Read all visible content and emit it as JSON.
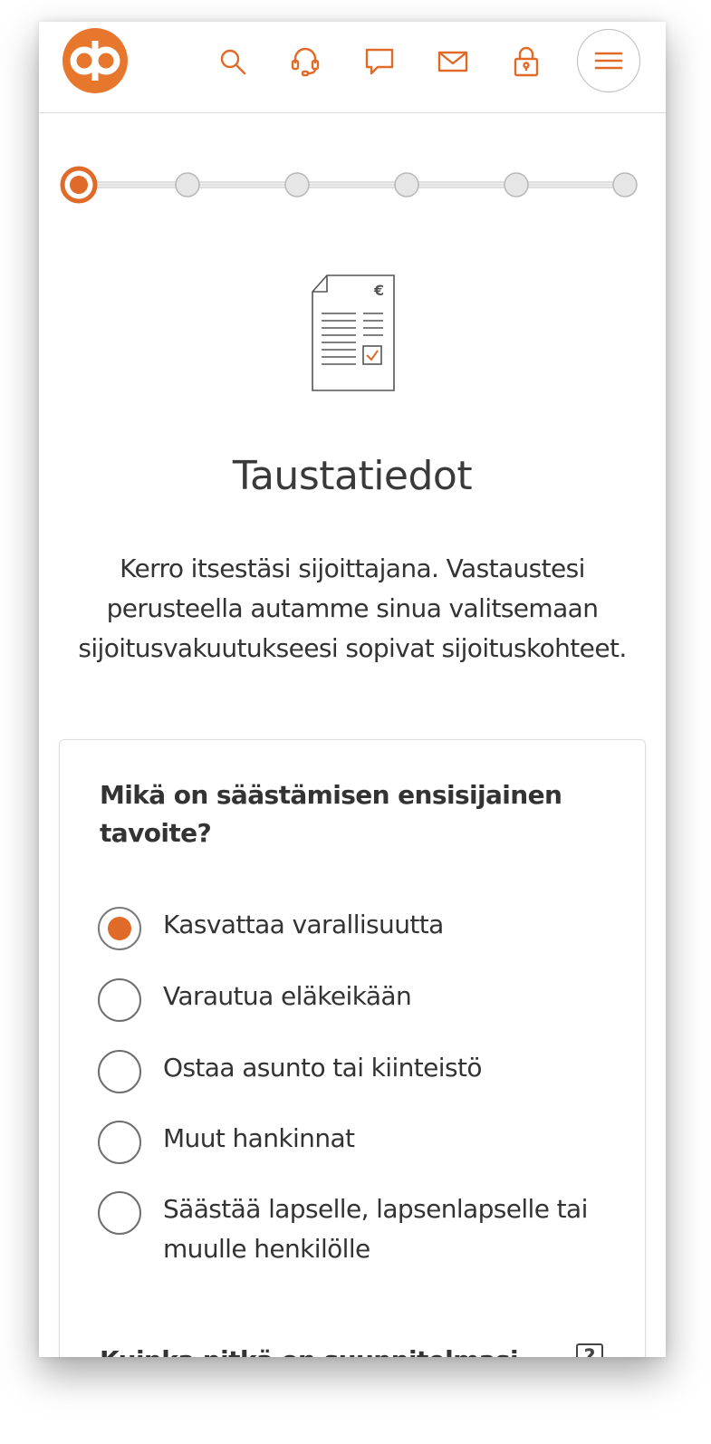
{
  "colors": {
    "brand_orange": "#e06a28",
    "text_dark": "#333333",
    "stepper_gray": "#e6e6e6",
    "border_gray": "#bdbdbd"
  },
  "header": {
    "logo": "op-logo",
    "icons": [
      "search-icon",
      "headset-icon",
      "chat-icon",
      "mail-icon",
      "lock-icon",
      "hamburger-menu-icon"
    ]
  },
  "stepper": {
    "total_steps": 6,
    "current_step": 1
  },
  "page": {
    "title": "Taustatiedot",
    "description": "Kerro itsestäsi sijoittajana. Vastaustesi perusteella autamme sinua valitsemaan sijoitusvakuutukseesi sopivat sijoituskohteet."
  },
  "question1": {
    "text": "Mikä on säästämisen ensisijainen tavoite?",
    "options": [
      {
        "label": "Kasvattaa varallisuutta",
        "selected": true
      },
      {
        "label": "Varautua eläkeikään",
        "selected": false
      },
      {
        "label": "Ostaa asunto tai kiinteistö",
        "selected": false
      },
      {
        "label": "Muut hankinnat",
        "selected": false
      },
      {
        "label": "Säästää lapselle, lapsenlapselle tai muulle henkilölle",
        "selected": false
      }
    ]
  },
  "question2": {
    "text": "Kuinka pitkä on suunnitelmasi",
    "help_symbol": "?"
  }
}
